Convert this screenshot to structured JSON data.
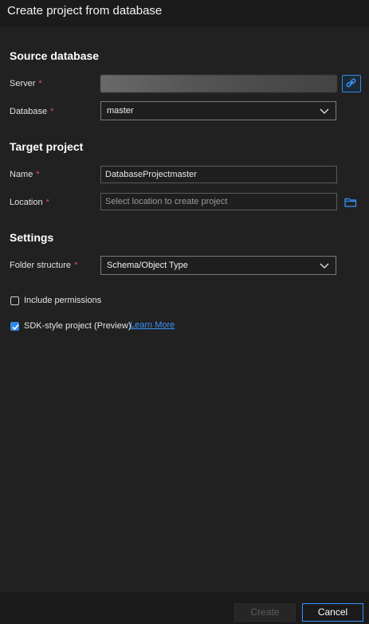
{
  "dialog": {
    "title": "Create project from database"
  },
  "source": {
    "heading": "Source database",
    "server_label": "Server",
    "database_label": "Database",
    "database_value": "master"
  },
  "target": {
    "heading": "Target project",
    "name_label": "Name",
    "name_value": "DatabaseProjectmaster",
    "location_label": "Location",
    "location_placeholder": "Select location to create project"
  },
  "settings": {
    "heading": "Settings",
    "folder_label": "Folder structure",
    "folder_value": "Schema/Object Type",
    "include_permissions_label": "Include permissions",
    "include_permissions_checked": false,
    "sdk_label": "SDK-style project (Preview)",
    "sdk_checked": true,
    "learn_more": "Learn More"
  },
  "required_marker": "*",
  "footer": {
    "create_label": "Create",
    "cancel_label": "Cancel"
  },
  "colors": {
    "accent": "#3794ff",
    "required": "#f14c4c",
    "background": "#212121"
  },
  "icons": [
    "link-icon",
    "chevron-down-icon",
    "folder-icon",
    "checkmark-icon"
  ]
}
